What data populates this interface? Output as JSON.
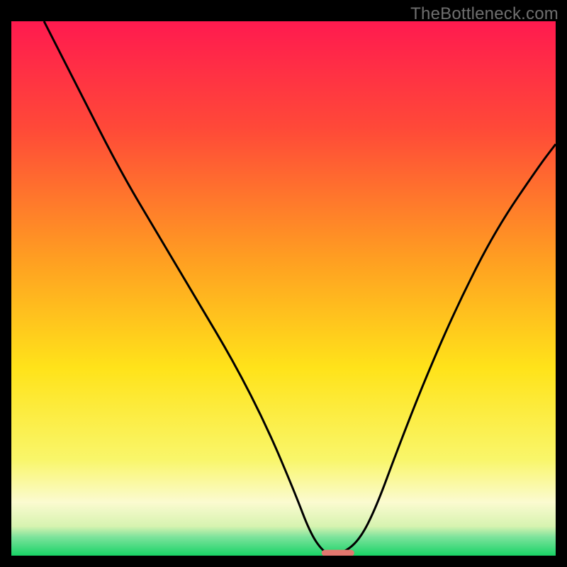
{
  "watermark": "TheBottleneck.com",
  "chart_data": {
    "type": "line",
    "title": "",
    "xlabel": "",
    "ylabel": "",
    "xlim": [
      0,
      100
    ],
    "ylim": [
      0,
      100
    ],
    "background_gradient": {
      "stops": [
        {
          "offset": 0.0,
          "color": "#ff1a4f"
        },
        {
          "offset": 0.2,
          "color": "#ff4938"
        },
        {
          "offset": 0.45,
          "color": "#ffa021"
        },
        {
          "offset": 0.65,
          "color": "#ffe31a"
        },
        {
          "offset": 0.82,
          "color": "#f9f66a"
        },
        {
          "offset": 0.9,
          "color": "#fbfbd0"
        },
        {
          "offset": 0.945,
          "color": "#d7f3b0"
        },
        {
          "offset": 0.965,
          "color": "#7de39c"
        },
        {
          "offset": 1.0,
          "color": "#18d366"
        }
      ]
    },
    "series": [
      {
        "name": "bottleneck-curve",
        "color": "#000000",
        "x": [
          6,
          12,
          20,
          27,
          34,
          41,
          47,
          52,
          55,
          57.5,
          59,
          61,
          64,
          67,
          71,
          76,
          82,
          89,
          97,
          100
        ],
        "y": [
          100,
          88,
          72,
          60,
          48,
          36,
          24,
          12,
          4,
          0.5,
          0.5,
          0.5,
          3,
          9,
          20,
          33,
          47,
          61,
          73,
          77
        ]
      }
    ],
    "marker": {
      "name": "optimal-region",
      "color": "#e2776f",
      "x_center": 60,
      "y": 0.5,
      "width": 6,
      "height": 1.2
    }
  }
}
